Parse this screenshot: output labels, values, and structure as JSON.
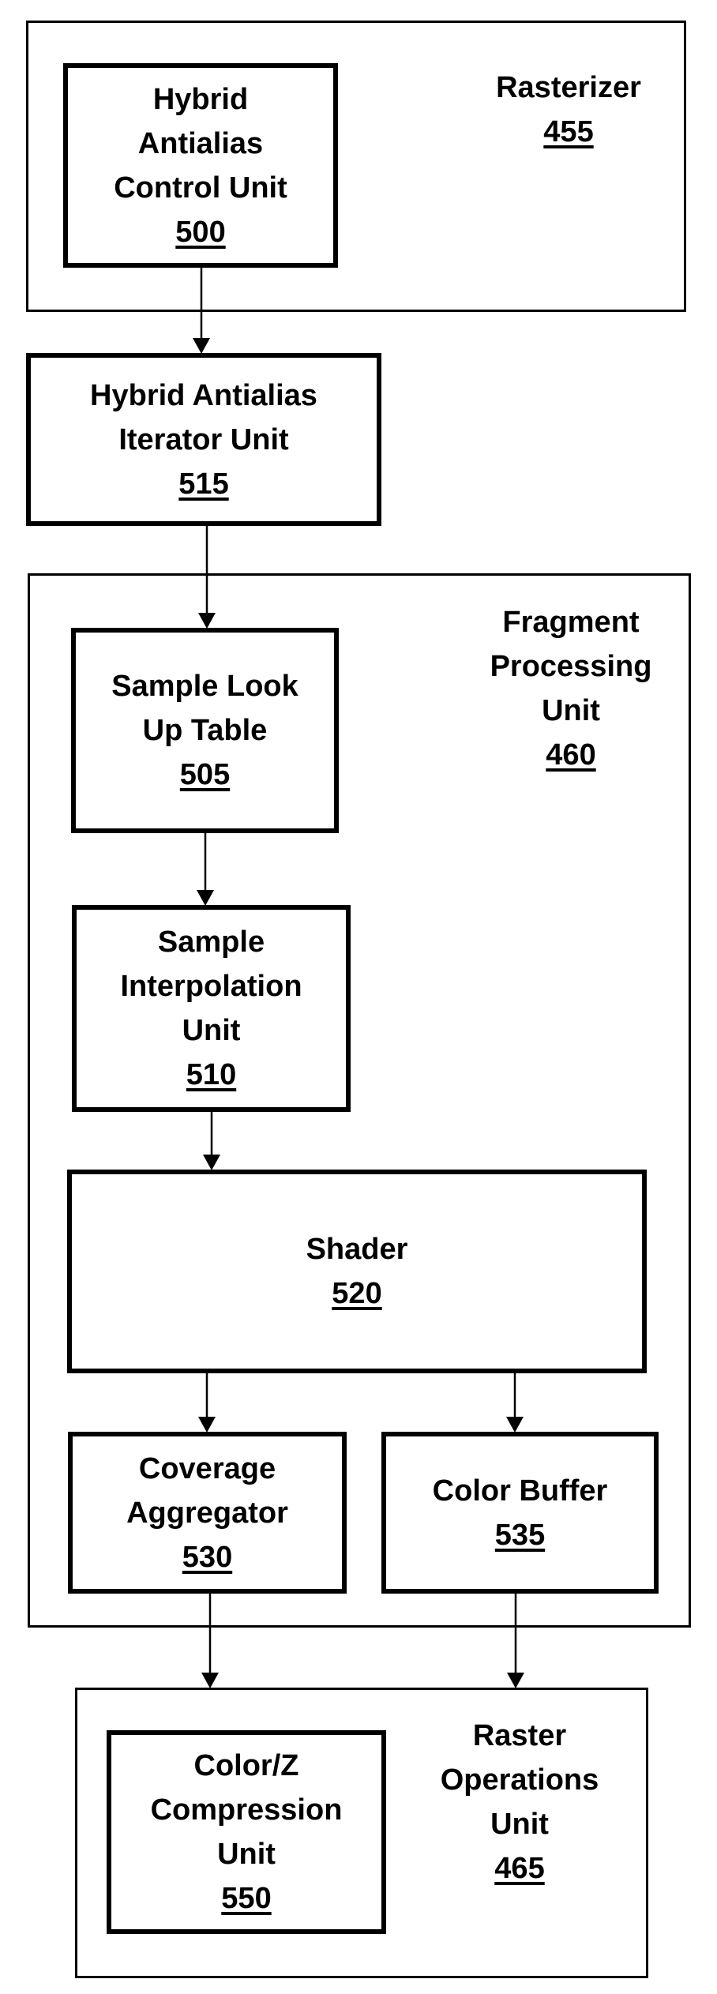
{
  "diagram": {
    "containers": {
      "rasterizer": {
        "lines": [
          "Rasterizer"
        ],
        "ref": "455"
      },
      "fragment_processing": {
        "lines": [
          "Fragment",
          "Processing",
          "Unit"
        ],
        "ref": "460"
      },
      "raster_operations": {
        "lines": [
          "Raster",
          "Operations",
          "Unit"
        ],
        "ref": "465"
      }
    },
    "blocks": {
      "control_unit": {
        "lines": [
          "Hybrid",
          "Antialias",
          "Control Unit"
        ],
        "ref": "500"
      },
      "iterator_unit": {
        "lines": [
          "Hybrid Antialias",
          "Iterator Unit"
        ],
        "ref": "515"
      },
      "sample_lut": {
        "lines": [
          "Sample Look",
          "Up Table"
        ],
        "ref": "505"
      },
      "sample_interp": {
        "lines": [
          "Sample",
          "Interpolation",
          "Unit"
        ],
        "ref": "510"
      },
      "shader": {
        "lines": [
          "Shader"
        ],
        "ref": "520"
      },
      "coverage_aggregator": {
        "lines": [
          "Coverage",
          "Aggregator"
        ],
        "ref": "530"
      },
      "color_buffer": {
        "lines": [
          "Color Buffer"
        ],
        "ref": "535"
      },
      "compression_unit": {
        "lines": [
          "Color/Z",
          "Compression",
          "Unit"
        ],
        "ref": "550"
      }
    },
    "edges": [
      {
        "from": "500",
        "to": "515"
      },
      {
        "from": "515",
        "to": "505"
      },
      {
        "from": "505",
        "to": "510"
      },
      {
        "from": "510",
        "to": "520"
      },
      {
        "from": "520",
        "to": "530"
      },
      {
        "from": "520",
        "to": "535"
      },
      {
        "from": "530",
        "to": "465"
      },
      {
        "from": "535",
        "to": "465"
      }
    ]
  }
}
